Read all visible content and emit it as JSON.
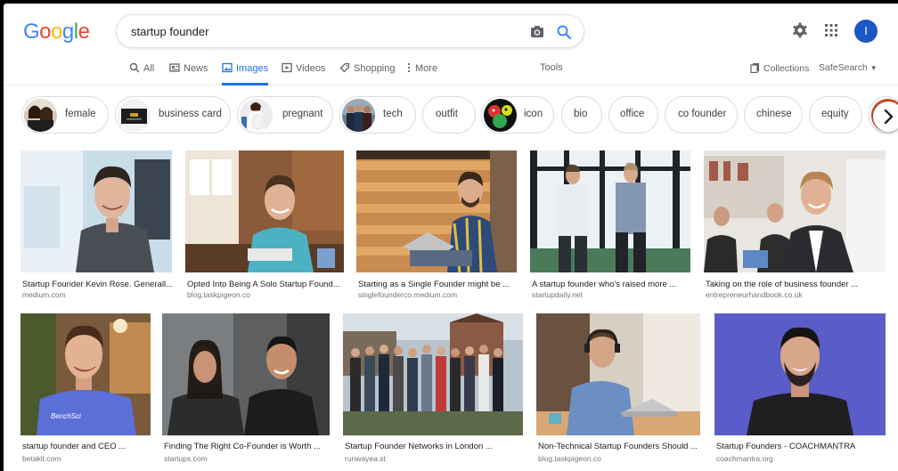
{
  "header": {
    "logo_letters": [
      {
        "ch": "G",
        "color": "#4285F4"
      },
      {
        "ch": "o",
        "color": "#EA4335"
      },
      {
        "ch": "o",
        "color": "#FBBC05"
      },
      {
        "ch": "g",
        "color": "#4285F4"
      },
      {
        "ch": "l",
        "color": "#34A853"
      },
      {
        "ch": "e",
        "color": "#EA4335"
      }
    ],
    "query": "startup founder",
    "camera_icon": "camera-icon",
    "search_icon": "search-icon",
    "settings_icon": "gear-icon",
    "apps_icon": "apps-grid-icon",
    "avatar_letter": "I"
  },
  "tabs": [
    {
      "label": "All",
      "icon": "search-icon",
      "active": false
    },
    {
      "label": "News",
      "icon": "news-icon",
      "active": false
    },
    {
      "label": "Images",
      "icon": "image-icon",
      "active": true
    },
    {
      "label": "Videos",
      "icon": "video-icon",
      "active": false
    },
    {
      "label": "Shopping",
      "icon": "tag-icon",
      "active": false
    },
    {
      "label": "More",
      "icon": "more-dots-icon",
      "active": false
    }
  ],
  "tools_label": "Tools",
  "collections_label": "Collections",
  "safesearch_label": "SafeSearch",
  "chips": [
    {
      "label": "female",
      "thumb": true
    },
    {
      "label": "business card",
      "thumb": true
    },
    {
      "label": "pregnant",
      "thumb": true
    },
    {
      "label": "tech",
      "thumb": true
    },
    {
      "label": "outfit",
      "thumb": false
    },
    {
      "label": "icon",
      "thumb": true
    },
    {
      "label": "bio",
      "thumb": false
    },
    {
      "label": "office",
      "thumb": false
    },
    {
      "label": "co founder",
      "thumb": false
    },
    {
      "label": "chinese",
      "thumb": false
    },
    {
      "label": "equity",
      "thumb": false
    }
  ],
  "results_row1": [
    {
      "caption": "Startup Founder Kevin Rose. Generall...",
      "source": "medium.com"
    },
    {
      "caption": "Opted Into Being A Solo Startup Found...",
      "source": "blog.taskpigeon.co"
    },
    {
      "caption": "Starting as a Single Founder might be ...",
      "source": "singlefounderco.medium.com"
    },
    {
      "caption": "A startup founder who's raised more ...",
      "source": "startupdaily.net"
    },
    {
      "caption": "Taking on the role of business founder ...",
      "source": "entrepreneurhandbook.co.uk"
    }
  ],
  "results_row2": [
    {
      "caption": "startup founder and CEO ...",
      "source": "betakit.com"
    },
    {
      "caption": "Finding The Right Co-Founder is Worth ...",
      "source": "startups.com"
    },
    {
      "caption": "Startup Founder Networks in London ...",
      "source": "runwayea.st"
    },
    {
      "caption": "Non-Technical Startup Founders Should ...",
      "source": "blog.taskpigeon.co"
    },
    {
      "caption": "Startup Founders - COACHMANTRA",
      "source": "coachmantra.org"
    }
  ],
  "shirt_text": "BenchSci"
}
